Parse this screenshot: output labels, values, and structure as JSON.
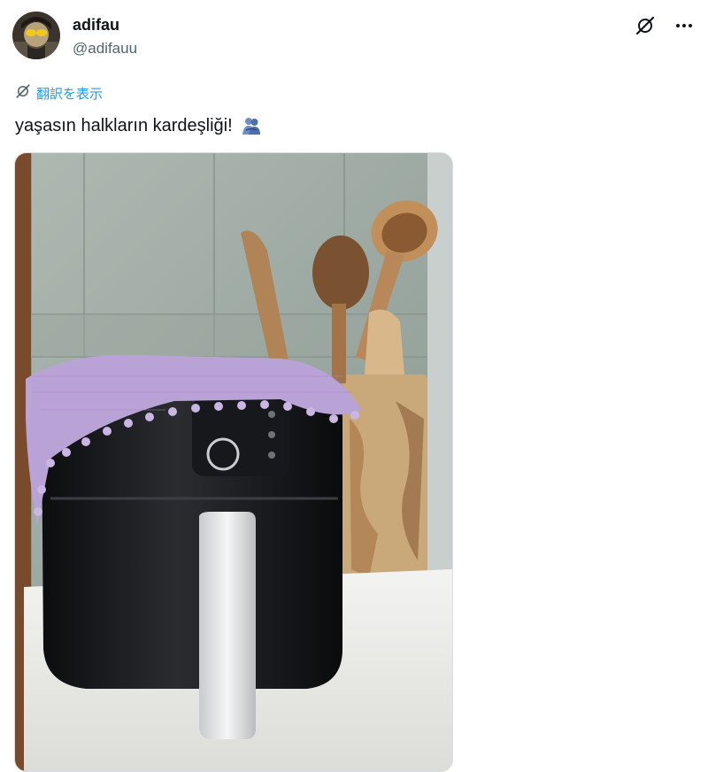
{
  "tweet": {
    "author": {
      "display_name": "adifau",
      "handle": "@adifauu",
      "avatar": "avatar-photo"
    },
    "header_icons": [
      "grok-icon",
      "more-icon"
    ],
    "translate": {
      "icon": "translate-icon",
      "label": "翻訳を表示"
    },
    "text": "yaşasın halkların kardeşliği!",
    "emoji": "people-hugging-emoji",
    "media": {
      "kind": "photo",
      "icon": "image"
    }
  }
}
